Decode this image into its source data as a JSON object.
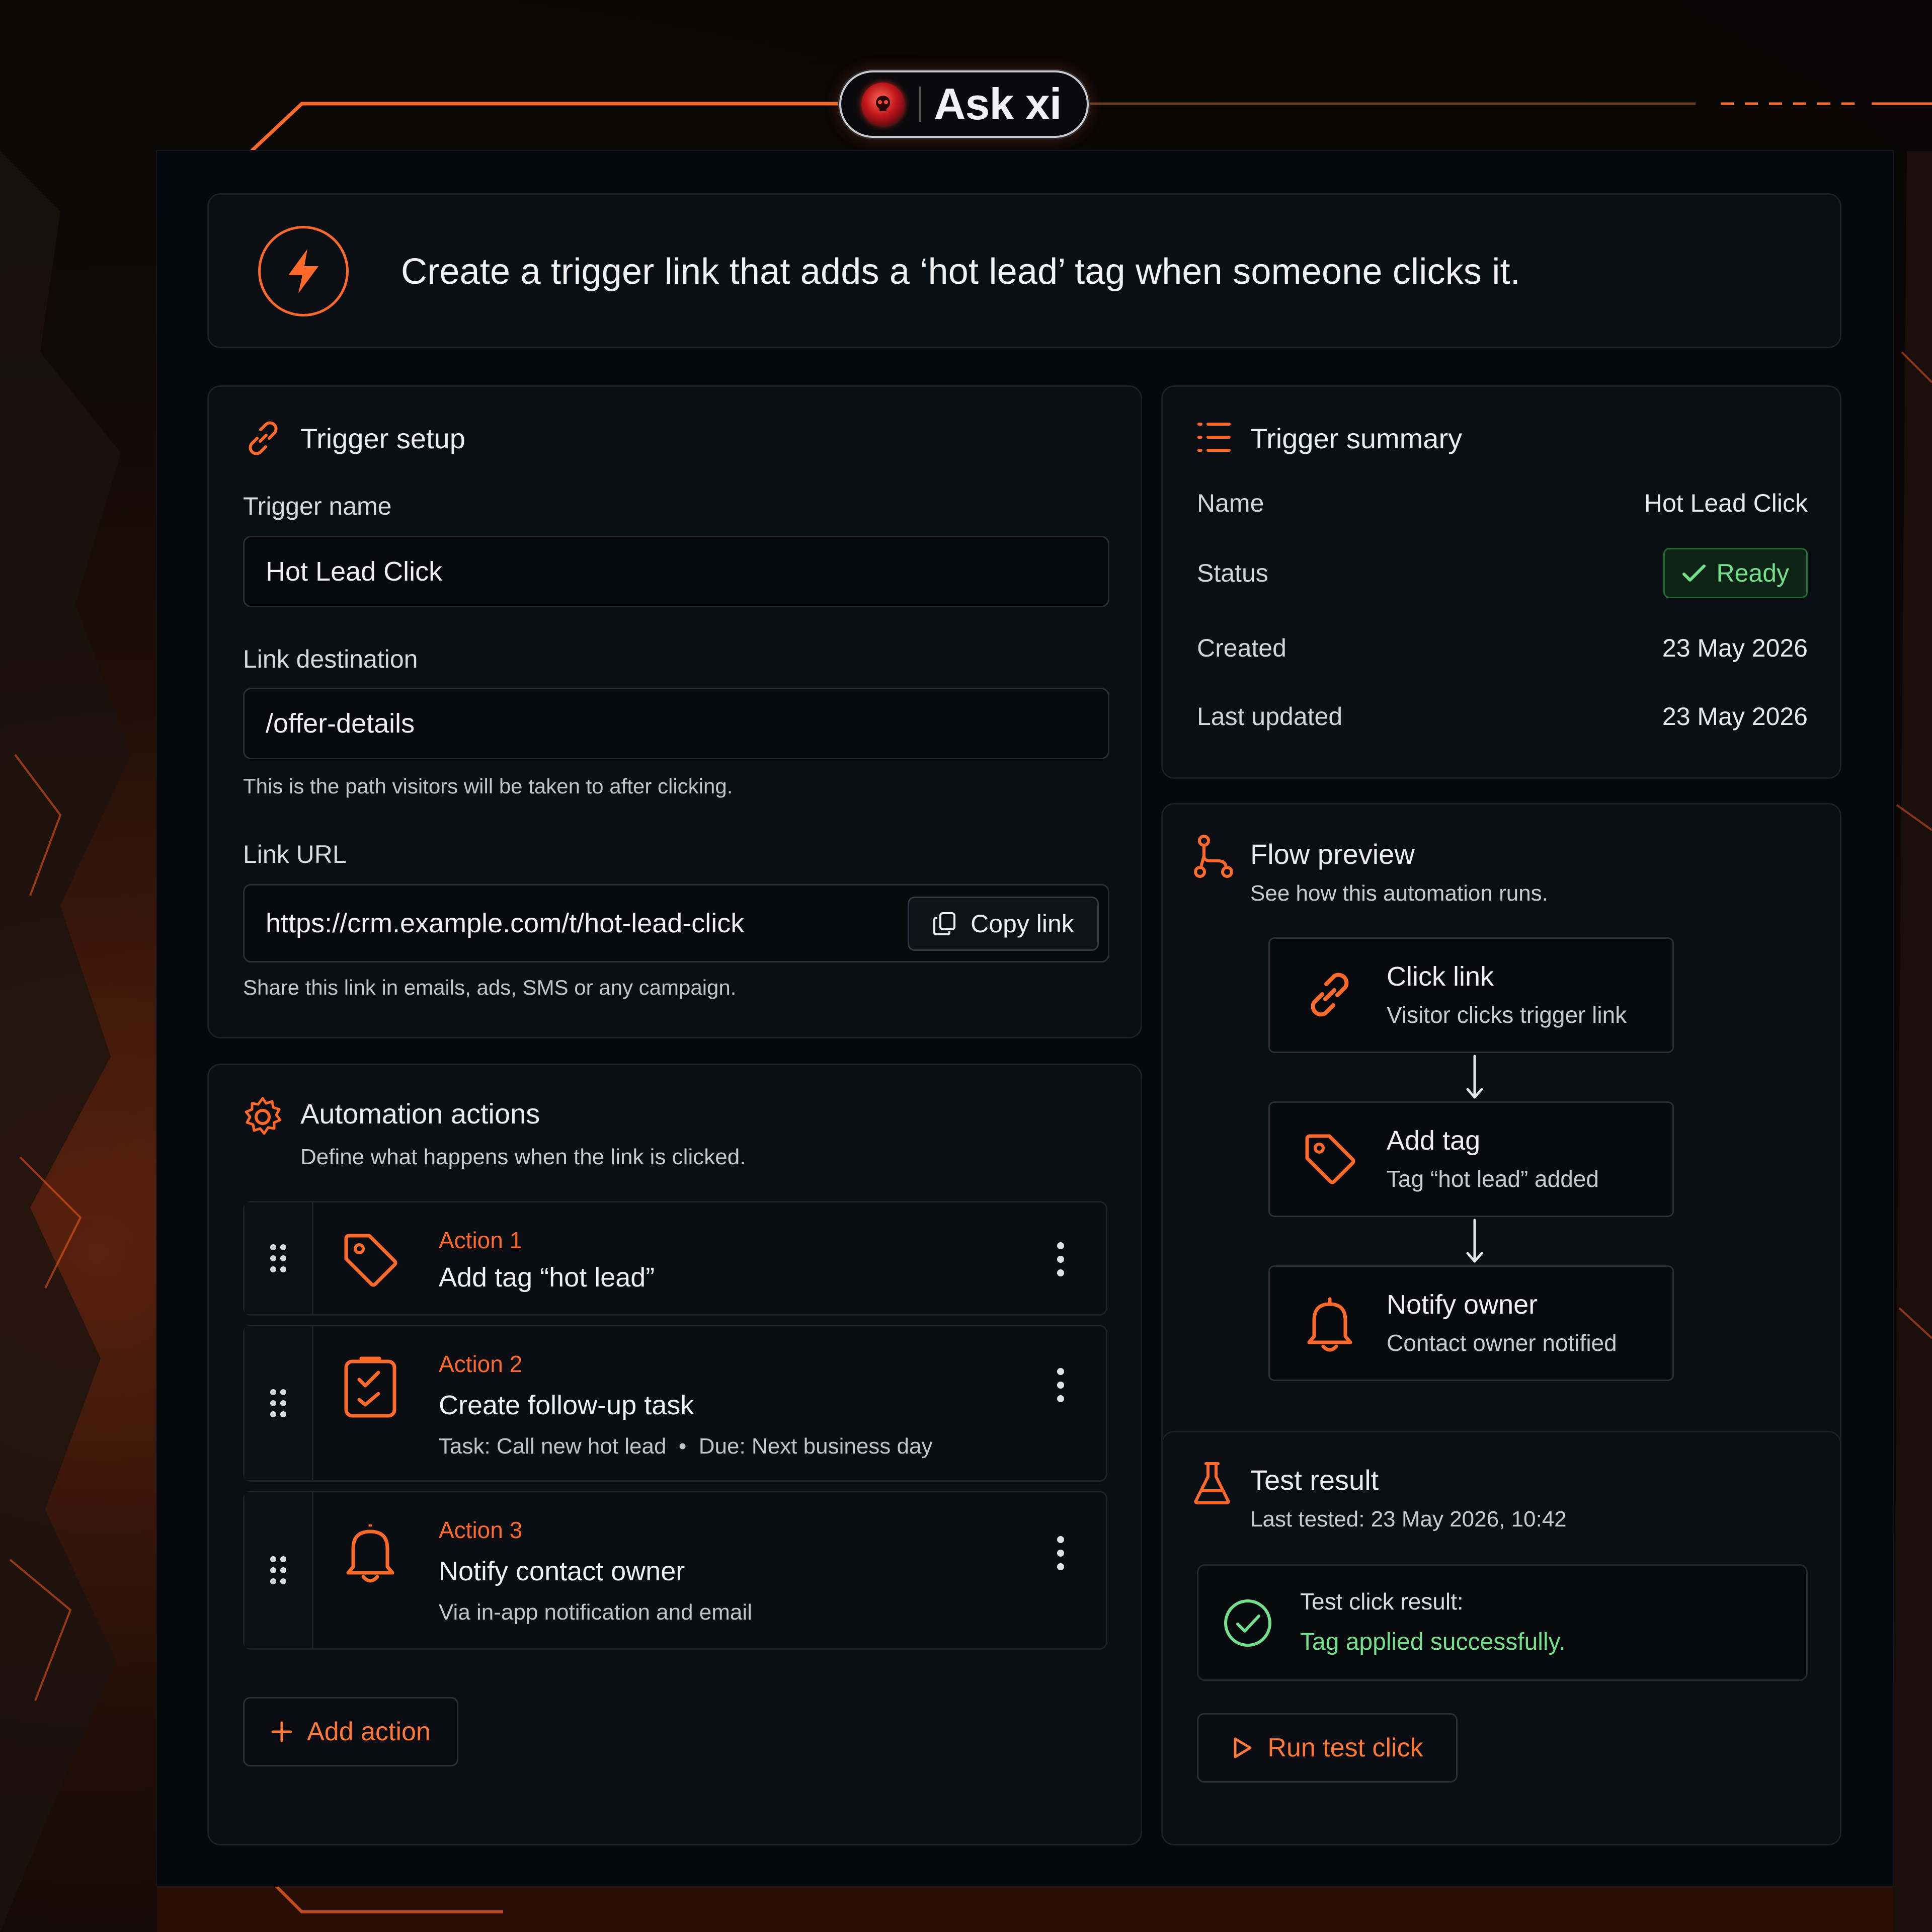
{
  "brand": {
    "name": "Ask xi",
    "logo_icon": "skull-orb-icon"
  },
  "colors": {
    "accent": "#ff6a2a",
    "success": "#73e08b",
    "panel": "#06080c",
    "card": "#0b0e13"
  },
  "prompt": {
    "icon": "lightning-bolt-icon",
    "text": "Create a trigger link that adds a ‘hot lead’ tag when someone clicks it."
  },
  "trigger_setup": {
    "title": "Trigger setup",
    "icon": "link-icon",
    "name_label": "Trigger name",
    "name_value": "Hot Lead Click",
    "destination_label": "Link destination",
    "destination_value": "/offer-details",
    "destination_hint": "This is the path visitors will be taken to after clicking.",
    "url_label": "Link URL",
    "url_value": "https://crm.example.com/t/hot-lead-click",
    "copy_label": "Copy link",
    "url_hint": "Share this link in emails, ads, SMS or any campaign."
  },
  "automation": {
    "title": "Automation actions",
    "icon": "gear-icon",
    "subtitle": "Define what happens when the link is clicked.",
    "actions": [
      {
        "kicker": "Action 1",
        "title": "Add tag “hot lead”",
        "desc": "",
        "icon": "tag-icon"
      },
      {
        "kicker": "Action 2",
        "title": "Create follow-up task",
        "desc": "Task: Call new hot lead  •  Due: Next business day",
        "icon": "task-checklist-icon"
      },
      {
        "kicker": "Action 3",
        "title": "Notify contact owner",
        "desc": "Via in-app notification and email",
        "icon": "bell-icon"
      }
    ],
    "add_label": "Add action"
  },
  "summary": {
    "title": "Trigger summary",
    "icon": "list-icon",
    "rows": [
      {
        "key": "Name",
        "value": "Hot Lead Click"
      },
      {
        "key": "Status",
        "value": "Ready"
      },
      {
        "key": "Created",
        "value": "23 May 2026"
      },
      {
        "key": "Last updated",
        "value": "23 May 2026"
      }
    ]
  },
  "flow": {
    "title": "Flow preview",
    "icon": "flow-nodes-icon",
    "subtitle": "See how this automation runs.",
    "steps": [
      {
        "title": "Click link",
        "sub": "Visitor clicks trigger link",
        "icon": "link-icon"
      },
      {
        "title": "Add tag",
        "sub": "Tag “hot lead” added",
        "icon": "tag-icon"
      },
      {
        "title": "Notify owner",
        "sub": "Contact owner notified",
        "icon": "bell-icon"
      }
    ]
  },
  "test": {
    "title": "Test result",
    "icon": "flask-icon",
    "last_tested": "Last tested: 23 May 2026, 10:42",
    "result_label": "Test click result:",
    "result_value": "Tag applied successfully.",
    "run_label": "Run test click"
  }
}
